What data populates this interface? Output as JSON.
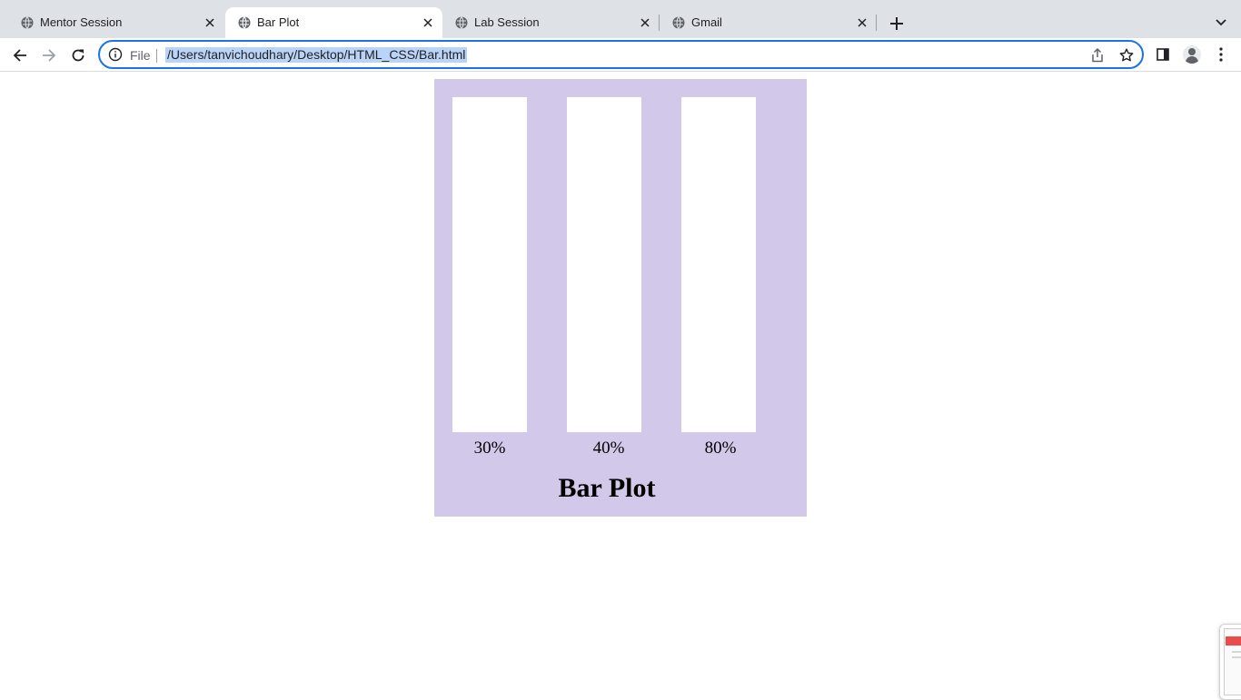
{
  "tabs": [
    {
      "label": "Mentor Session",
      "active": false,
      "icon": "globe-icon"
    },
    {
      "label": "Bar Plot",
      "active": true,
      "icon": "globe-icon"
    },
    {
      "label": "Lab Session",
      "active": false,
      "icon": "globe-icon"
    },
    {
      "label": "Gmail",
      "active": false,
      "icon": "globe-icon"
    }
  ],
  "omnibox": {
    "scheme": "File",
    "url": "/Users/tanvichoudhary/Desktop/HTML_CSS/Bar.html"
  },
  "colors": {
    "plot_background": "#d2c8ea",
    "bar_fill": "#ffffff",
    "focus_ring": "#1a73e8",
    "url_selection": "#b9d4f7"
  },
  "page": {
    "bars": [
      {
        "label": "30%"
      },
      {
        "label": "40%"
      },
      {
        "label": "80%"
      }
    ],
    "title": "Bar Plot"
  }
}
